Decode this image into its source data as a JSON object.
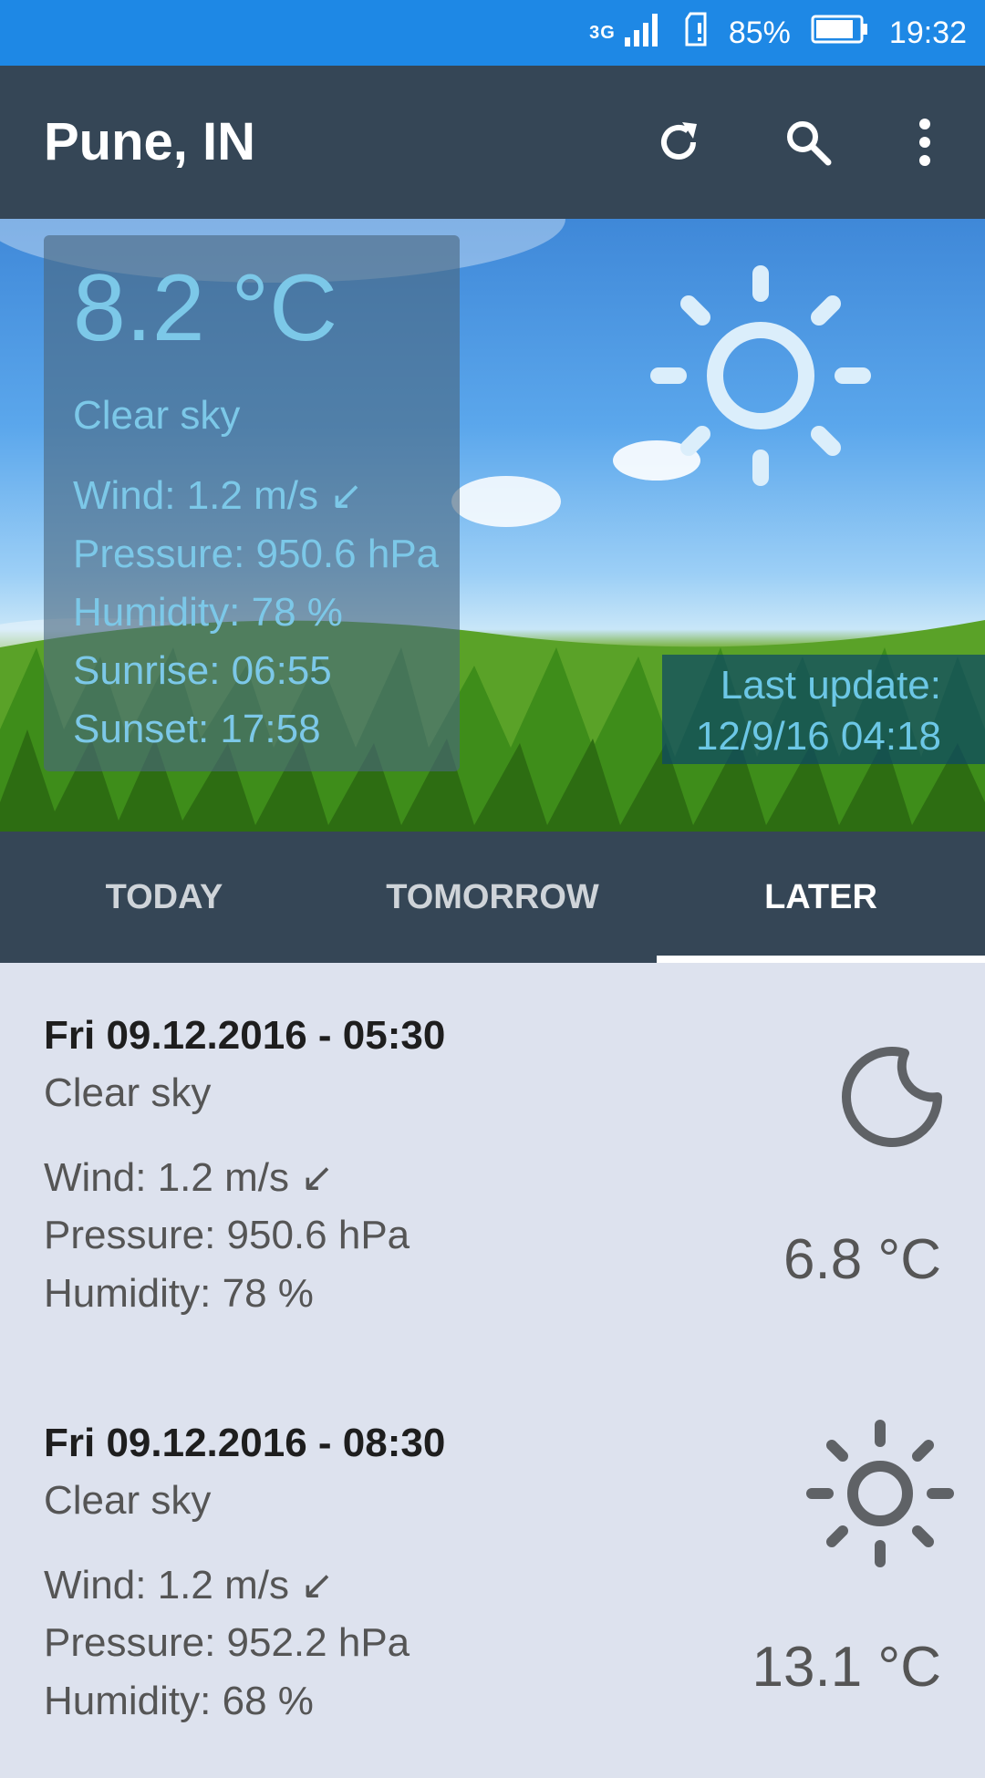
{
  "status_bar": {
    "network": "3G",
    "battery": "85%",
    "time": "19:32"
  },
  "app_bar": {
    "title": "Pune, IN",
    "actions": [
      "refresh-icon",
      "search-icon",
      "more-vert-icon"
    ]
  },
  "current": {
    "temperature": "8.2 °C",
    "description": "Clear sky",
    "wind": "Wind: 1.2 m/s ↙",
    "pressure": "Pressure: 950.6 hPa",
    "humidity": " Humidity: 78 %",
    "sunrise": "Sunrise: 06:55",
    "sunset": "Sunset: 17:58",
    "icon": "sun-icon",
    "last_update_label": "Last update:",
    "last_update_value": "12/9/16 04:18"
  },
  "tabs": [
    {
      "label": "TODAY",
      "active": false
    },
    {
      "label": "TOMORROW",
      "active": false
    },
    {
      "label": "LATER",
      "active": true
    }
  ],
  "forecast": [
    {
      "date": "Fri 09.12.2016 - 05:30",
      "description": "Clear sky",
      "wind": "Wind: 1.2 m/s ↙",
      "pressure": "Pressure: 950.6 hPa",
      "humidity": "Humidity: 78 %",
      "temperature": "6.8 °C",
      "icon": "moon-icon"
    },
    {
      "date": "Fri 09.12.2016 - 08:30",
      "description": "Clear sky",
      "wind": "Wind: 1.2 m/s ↙",
      "pressure": "Pressure: 952.2 hPa",
      "humidity": "Humidity: 68 %",
      "temperature": "13.1 °C",
      "icon": "sun-icon"
    }
  ],
  "colors": {
    "status_bar": "#1e88e5",
    "app_bar": "#354656",
    "list_background": "#dde2ee",
    "hero_text": "#7cc8e8"
  }
}
